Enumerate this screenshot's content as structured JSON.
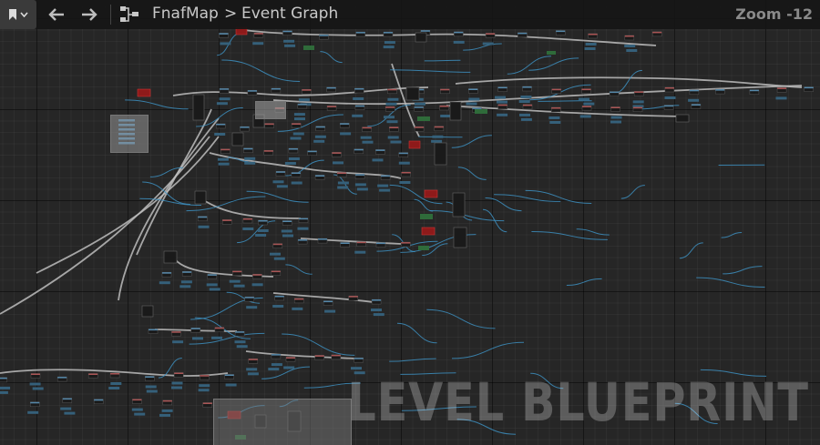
{
  "toolbar": {
    "bookmark_icon": "bookmark-icon",
    "back_icon": "arrow-left-icon",
    "forward_icon": "arrow-right-icon",
    "graph_icon": "node-graph-icon",
    "breadcrumb": [
      "FnafMap",
      "Event Graph"
    ],
    "breadcrumb_separator": ">",
    "zoom": "Zoom -12"
  },
  "watermark": "LEVEL BLUEPRINT",
  "colors": {
    "background": "#262626",
    "wire_exec": "#bdbdbd",
    "wire_data": "#3d8fbf",
    "node_dark": "#1a1a1a",
    "node_red": "#8e1a1a",
    "node_green": "#2f6b3a",
    "comment": "#7c7c7c"
  }
}
